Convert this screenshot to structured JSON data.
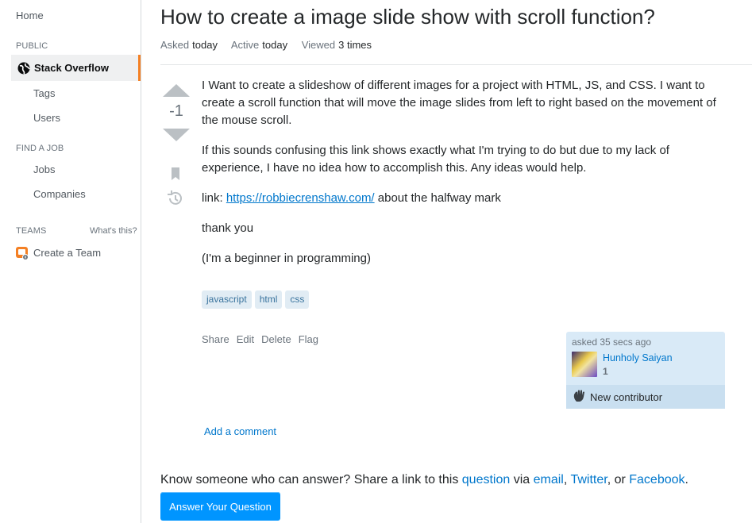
{
  "sidebar": {
    "home": "Home",
    "public_label": "PUBLIC",
    "active_item": "Stack Overflow",
    "tags": "Tags",
    "users": "Users",
    "find_job_label": "FIND A JOB",
    "jobs": "Jobs",
    "companies": "Companies",
    "teams_label": "TEAMS",
    "whats_this": "What's this?",
    "create_team": "Create a Team"
  },
  "question": {
    "title": "How to create a image slide show with scroll function?",
    "asked_label": "Asked",
    "asked_value": "today",
    "active_label": "Active",
    "active_value": "today",
    "viewed_label": "Viewed",
    "viewed_value": "3 times",
    "score": "-1",
    "paragraph1": "I Want to create a slideshow of different images for a project with HTML, JS, and CSS. I want to create a scroll function that will move the image slides from left to right based on the movement of the mouse scroll.",
    "paragraph2": "If this sounds confusing this link shows exactly what I'm trying to do but due to my lack of experience, I have no idea how to accomplish this. Any ideas would help.",
    "link_prefix": "link: ",
    "link_text": "https://robbiecrenshaw.com/",
    "link_suffix": " about the halfway mark",
    "paragraph4": "thank you",
    "paragraph5": "(I'm a beginner in programming)",
    "tags": [
      "javascript",
      "html",
      "css"
    ],
    "menu": [
      "Share",
      "Edit",
      "Delete",
      "Flag"
    ]
  },
  "user_card": {
    "asked_time": "asked 35 secs ago",
    "name": "Hunholy Saiyan",
    "reputation": "1",
    "new_contributor": "New contributor"
  },
  "comments": {
    "add_comment": "Add a comment"
  },
  "share": {
    "prefix": "Know someone who can answer? Share a link to this ",
    "question_link": "question",
    "via": " via ",
    "email": "email",
    "comma1": ", ",
    "twitter": "Twitter",
    "or": ", or ",
    "facebook": "Facebook",
    "period": "."
  },
  "answer_button": "Answer Your Question",
  "colors": {
    "accent": "#f48024",
    "link": "#0077cc",
    "button": "#0095ff",
    "tag_bg": "#e1ecf4"
  }
}
